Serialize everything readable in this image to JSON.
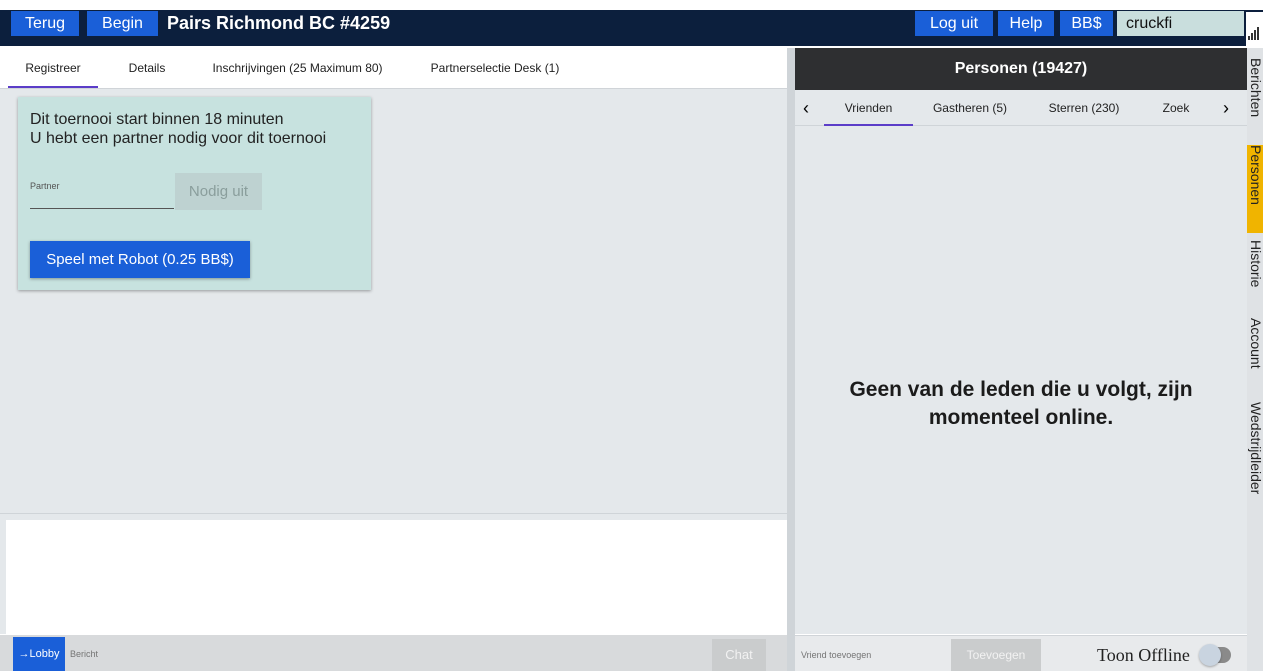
{
  "topbar": {
    "back_label": "Terug",
    "start_label": "Begin",
    "title": "Pairs Richmond BC #4259",
    "logout_label": "Log uit",
    "help_label": "Help",
    "bb_label": "BB$",
    "username": "cruckfi"
  },
  "left_tabs": [
    {
      "label": "Registreer",
      "active": true
    },
    {
      "label": "Details",
      "active": false
    },
    {
      "label": "Inschrijvingen (25 Maximum 80)",
      "active": false
    },
    {
      "label": "Partnerselectie Desk (1)",
      "active": false
    }
  ],
  "register_card": {
    "line1": "Dit toernooi start binnen 18 minuten",
    "line2": "U hebt een partner nodig voor dit toernooi",
    "partner_label": "Partner",
    "invite_label": "Nodig uit",
    "robot_label": "Speel met Robot (0.25 BB$)"
  },
  "chat": {
    "lobby_label": "→Lobby",
    "message_placeholder": "Bericht",
    "chat_label": "Chat"
  },
  "people": {
    "header": "Personen (19427)",
    "tabs": [
      {
        "label": "Vrienden",
        "active": true
      },
      {
        "label": "Gastheren (5)",
        "active": false
      },
      {
        "label": "Sterren (230)",
        "active": false
      },
      {
        "label": "Zoek",
        "active": false
      }
    ],
    "prev_icon": "‹",
    "next_icon": "›",
    "empty_message": "Geen van de leden die u volgt, zijn momenteel online.",
    "add_friend_placeholder": "Vriend toevoegen",
    "add_label": "Toevoegen",
    "show_offline_label": "Toon Offline",
    "show_offline_on": false
  },
  "side_tabs": [
    {
      "label": "Berichten",
      "active": false
    },
    {
      "label": "Personen",
      "active": true
    },
    {
      "label": "Historie",
      "active": false
    },
    {
      "label": "Account",
      "active": false
    },
    {
      "label": "Wedstrijdleider",
      "active": false
    }
  ],
  "colors": {
    "topbar_bg": "#0c1f3d",
    "primary_button": "#1a5fd8",
    "tab_indicator": "#5b3dc8",
    "active_side_tab": "#f0b400",
    "card_bg": "#c7e2df"
  }
}
